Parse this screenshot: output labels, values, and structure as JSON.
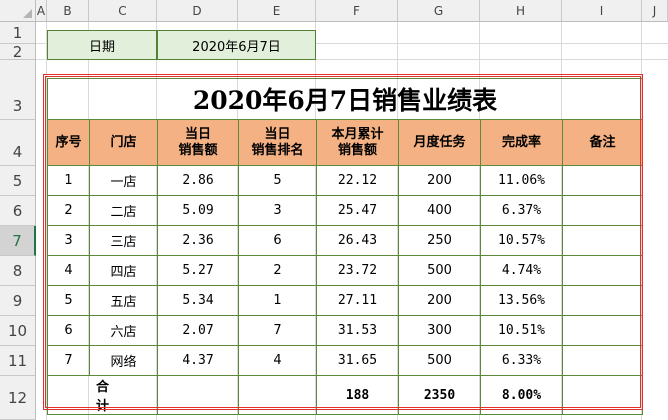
{
  "columns": [
    "A",
    "B",
    "C",
    "D",
    "E",
    "F",
    "G",
    "H",
    "I",
    "J"
  ],
  "rows": [
    "1",
    "2",
    "3",
    "4",
    "5",
    "6",
    "7",
    "8",
    "9",
    "10",
    "11",
    "12"
  ],
  "selected_row": "7",
  "info": {
    "date_label": "日期",
    "date_value": "2020年6月7日"
  },
  "table": {
    "title": "2020年6月7日销售业绩表",
    "headers": {
      "seq": "序号",
      "store": "门店",
      "daily_sales": [
        "当日",
        "销售额"
      ],
      "daily_rank": [
        "当日",
        "销售排名"
      ],
      "month_cum": [
        "本月累计",
        "销售额"
      ],
      "month_target": "月度任务",
      "completion": "完成率",
      "note": "备注"
    },
    "rows": [
      {
        "seq": "1",
        "store": "一店",
        "sales": "2.86",
        "rank": "5",
        "cum": "22.12",
        "target": "200",
        "rate": "11.06%",
        "note": ""
      },
      {
        "seq": "2",
        "store": "二店",
        "sales": "5.09",
        "rank": "3",
        "cum": "25.47",
        "target": "400",
        "rate": "6.37%",
        "note": ""
      },
      {
        "seq": "3",
        "store": "三店",
        "sales": "2.36",
        "rank": "6",
        "cum": "26.43",
        "target": "250",
        "rate": "10.57%",
        "note": ""
      },
      {
        "seq": "4",
        "store": "四店",
        "sales": "5.27",
        "rank": "2",
        "cum": "23.72",
        "target": "500",
        "rate": "4.74%",
        "note": ""
      },
      {
        "seq": "5",
        "store": "五店",
        "sales": "5.34",
        "rank": "1",
        "cum": "27.11",
        "target": "200",
        "rate": "13.56%",
        "note": ""
      },
      {
        "seq": "6",
        "store": "六店",
        "sales": "2.07",
        "rank": "7",
        "cum": "31.53",
        "target": "300",
        "rate": "10.51%",
        "note": ""
      },
      {
        "seq": "7",
        "store": "网络",
        "sales": "4.37",
        "rank": "4",
        "cum": "31.65",
        "target": "500",
        "rate": "6.33%",
        "note": ""
      }
    ],
    "total": {
      "label": "合计",
      "cum": "188",
      "target": "2350",
      "rate": "8.00%"
    }
  },
  "colors": {
    "header_fill": "#f4b183",
    "info_fill": "#e2efda",
    "border_green": "#5b8a3a",
    "frame_red": "#e0312b",
    "selection_green": "#217346"
  }
}
